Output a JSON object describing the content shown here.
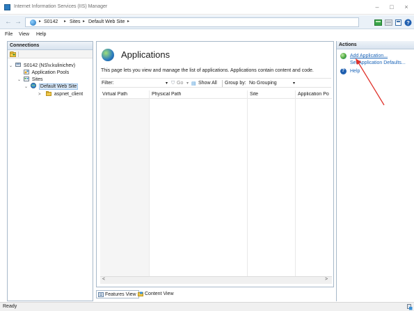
{
  "window": {
    "title": "Internet Information Services (IIS) Manager",
    "minimize": "–",
    "maximize": "□",
    "close": "×"
  },
  "address": {
    "back": "←",
    "forward": "→",
    "crumbs": [
      "S0142",
      "Sites",
      "Default Web Site"
    ],
    "separator": "▸"
  },
  "menu": [
    "File",
    "View",
    "Help"
  ],
  "connections": {
    "header": "Connections",
    "tree": [
      {
        "label": "S0142 (NS\\v.kulinichev)",
        "toggle": "⌄",
        "icon": "server-icon"
      },
      {
        "label": "Application Pools",
        "toggle": "",
        "icon": "app-pools-icon"
      },
      {
        "label": "Sites",
        "toggle": "⌄",
        "icon": "sites-folder-icon"
      },
      {
        "label": "Default Web Site",
        "toggle": "⌄",
        "icon": "globe-icon"
      },
      {
        "label": "aspnet_client",
        "toggle": ">",
        "icon": "folder-icon"
      }
    ]
  },
  "main": {
    "title": "Applications",
    "description": "This page lets you view and manage the list of applications. Applications contain content and code.",
    "filter_label": "Filter:",
    "go_label": "Go",
    "show_all_label": "Show All",
    "group_by_label": "Group by:",
    "group_by_value": "No Grouping",
    "columns": [
      "Virtual Path",
      "Physical Path",
      "Site",
      "Application Po"
    ],
    "scroll_left": "<",
    "scroll_right": ">"
  },
  "view_tabs": [
    "Features View",
    "Content View"
  ],
  "actions": {
    "header": "Actions",
    "items": [
      {
        "label": "Add Application...",
        "icon": "add-application-icon"
      },
      {
        "label": "Set Application Defaults...",
        "icon": ""
      },
      {
        "label": "Help",
        "icon": "help-icon"
      }
    ]
  },
  "status": {
    "text": "Ready"
  },
  "colors": {
    "accent": "#1a64b8",
    "annotation_arrow": "#e0322b",
    "panel_border": "#a7b8c9"
  }
}
